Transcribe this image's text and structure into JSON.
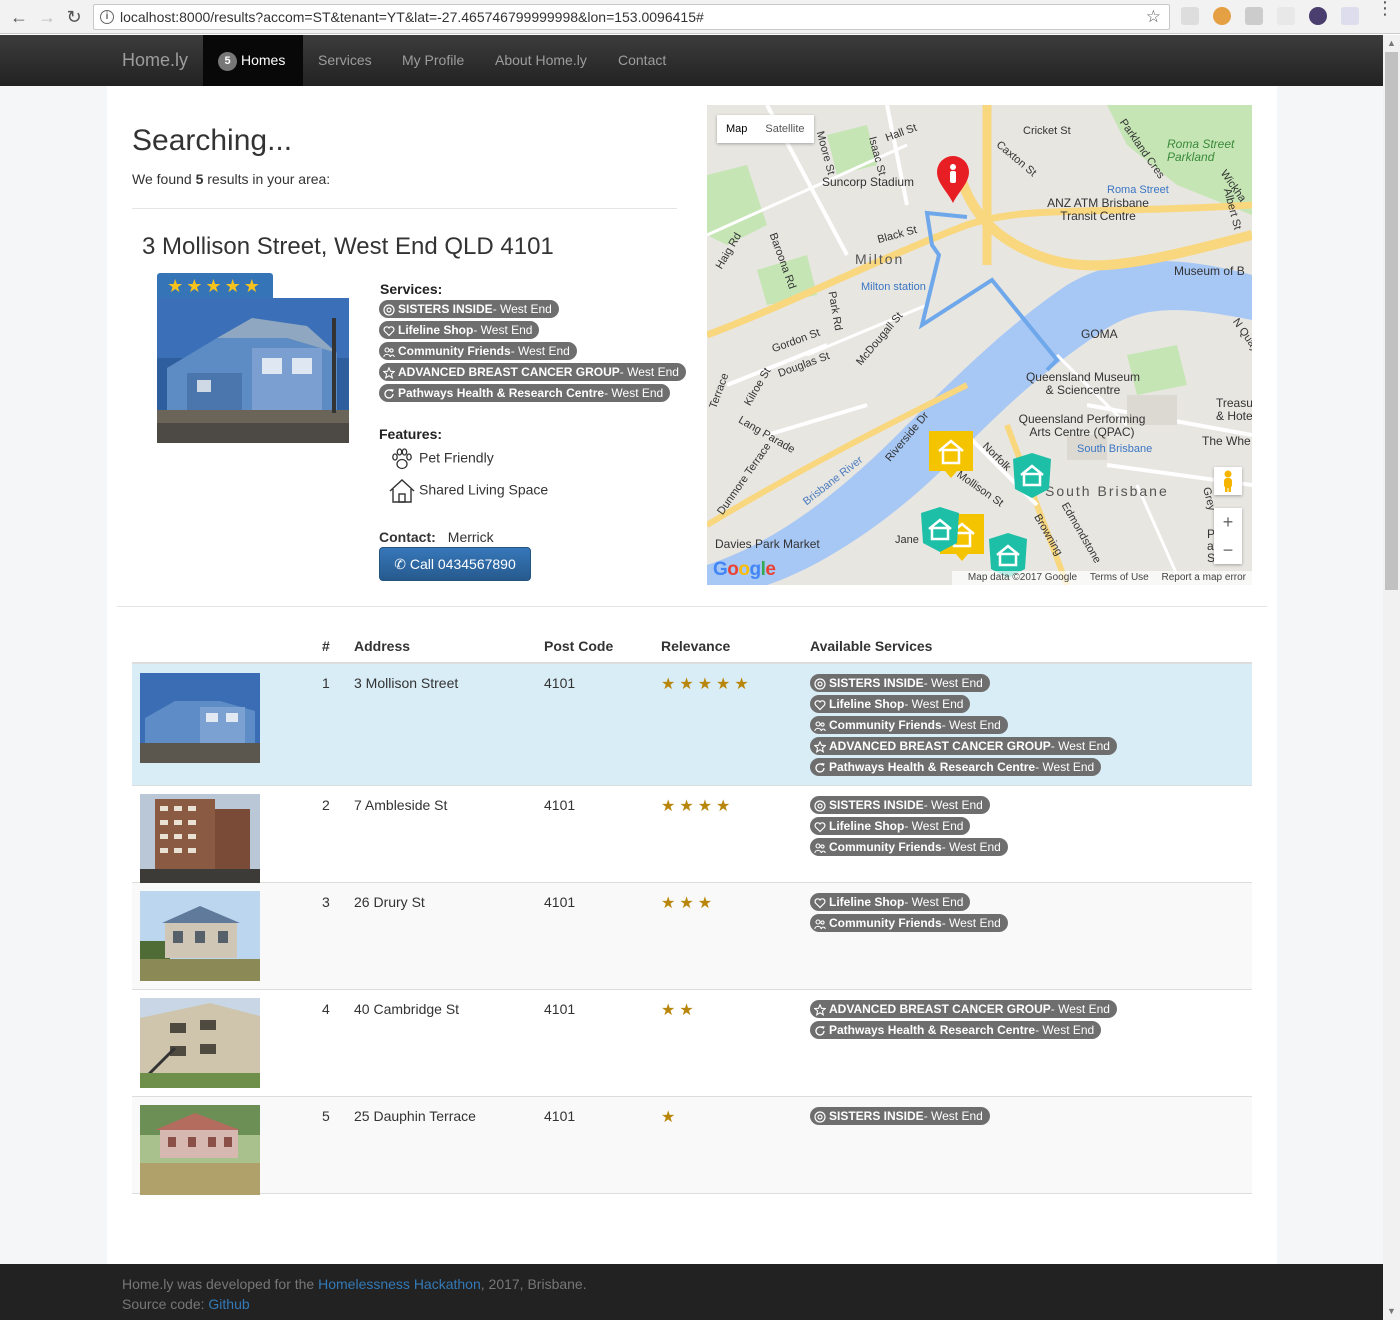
{
  "browser": {
    "url": "localhost:8000/results?accom=ST&tenant=YT&lat=-27.465746799999998&lon=153.0096415#"
  },
  "nav": {
    "brand": "Home.ly",
    "homes_count": "5",
    "items": [
      "Homes",
      "Services",
      "My Profile",
      "About Home.ly",
      "Contact"
    ]
  },
  "search": {
    "title": "Searching...",
    "found_prefix": "We found ",
    "found_count": "5",
    "found_suffix": " results in your area:"
  },
  "featured": {
    "address": "3 Mollison Street, West End QLD 4101",
    "rating": "★★★★★",
    "services_label": "Services:",
    "services": [
      {
        "icon": "support-icon",
        "name": "SISTERS INSIDE",
        "suffix": " - West End"
      },
      {
        "icon": "heart-icon",
        "name": "Lifeline Shop",
        "suffix": " - West End"
      },
      {
        "icon": "people-icon",
        "name": "Community Friends",
        "suffix": " - West End"
      },
      {
        "icon": "star-icon",
        "name": "ADVANCED BREAST CANCER GROUP",
        "suffix": " - West End"
      },
      {
        "icon": "refresh-icon",
        "name": "Pathways Health & Research Centre",
        "suffix": " - West End"
      }
    ],
    "features_label": "Features:",
    "features": [
      "Pet Friendly",
      "Shared Living Space"
    ],
    "contact_label": "Contact:",
    "contact_name": "Merrick",
    "call_label": "Call 0434567890"
  },
  "map": {
    "type_map": "Map",
    "type_satellite": "Satellite",
    "zoom_in": "+",
    "zoom_out": "−",
    "attribution": [
      "Map data ©2017 Google",
      "Terms of Use",
      "Report a map error"
    ],
    "labels": [
      "Suncorp Stadium",
      "Milton",
      "Milton station",
      "ANZ ATM Brisbane Transit Centre",
      "Roma Street Parkland",
      "Roma Street",
      "Museum of B",
      "GOMA",
      "Queensland Museum & Sciencentre",
      "Queensland Performing Arts Centre (QPAC)",
      "South Brisbane",
      "Brisbane River",
      "Davies Park Market",
      "Hall St",
      "Cricket St",
      "Caxton St",
      "Black St",
      "Park Rd",
      "Gordon St",
      "Douglas St",
      "McDougall St",
      "Lang Parade",
      "Dunmore Terrace",
      "Riverside Dr",
      "Mollison St",
      "Norfolk",
      "Jane",
      "Edmondstone",
      "Browning",
      "Baroona Rd",
      "Haig Rd",
      "Kilroe St",
      "Isaac St",
      "Moore St",
      "Parkland Cres",
      "Treasu & Hote",
      "The Whe",
      "Par at S",
      "Grey",
      "N Quay",
      "Wickha",
      "Albert St",
      "South Brisbane",
      "Terrace"
    ],
    "colors": {
      "water": "#a7c7f5",
      "road": "#f9d77f",
      "park": "#c5e5b5",
      "route": "#6fa8ea",
      "marker_home": "#f5c400",
      "marker_service": "#1dbfa7",
      "user_pin": "#e81e25"
    }
  },
  "table": {
    "headers": [
      "#",
      "Address",
      "Post Code",
      "Relevance",
      "Available Services"
    ],
    "rows": [
      {
        "num": "1",
        "address": "3 Mollison Street",
        "postcode": "4101",
        "stars": "★★★★★",
        "services": [
          {
            "icon": "support-icon",
            "name": "SISTERS INSIDE",
            "suffix": " - West End"
          },
          {
            "icon": "heart-icon",
            "name": "Lifeline Shop",
            "suffix": " - West End"
          },
          {
            "icon": "people-icon",
            "name": "Community Friends",
            "suffix": " - West End"
          },
          {
            "icon": "star-icon",
            "name": "ADVANCED BREAST CANCER GROUP",
            "suffix": " - West End"
          },
          {
            "icon": "refresh-icon",
            "name": "Pathways Health & Research Centre",
            "suffix": " - West End"
          }
        ]
      },
      {
        "num": "2",
        "address": "7 Ambleside St",
        "postcode": "4101",
        "stars": "★★★★",
        "services": [
          {
            "icon": "support-icon",
            "name": "SISTERS INSIDE",
            "suffix": " - West End"
          },
          {
            "icon": "heart-icon",
            "name": "Lifeline Shop",
            "suffix": " - West End"
          },
          {
            "icon": "people-icon",
            "name": "Community Friends",
            "suffix": " - West End"
          }
        ]
      },
      {
        "num": "3",
        "address": "26 Drury St",
        "postcode": "4101",
        "stars": "★★★",
        "services": [
          {
            "icon": "heart-icon",
            "name": "Lifeline Shop",
            "suffix": " - West End"
          },
          {
            "icon": "people-icon",
            "name": "Community Friends",
            "suffix": " - West End"
          }
        ]
      },
      {
        "num": "4",
        "address": "40 Cambridge St",
        "postcode": "4101",
        "stars": "★★",
        "services": [
          {
            "icon": "star-icon",
            "name": "ADVANCED BREAST CANCER GROUP",
            "suffix": " - West End"
          },
          {
            "icon": "refresh-icon",
            "name": "Pathways Health & Research Centre",
            "suffix": " - West End"
          }
        ]
      },
      {
        "num": "5",
        "address": "25 Dauphin Terrace",
        "postcode": "4101",
        "stars": "★",
        "services": [
          {
            "icon": "support-icon",
            "name": "SISTERS INSIDE",
            "suffix": " - West End"
          }
        ]
      }
    ]
  },
  "footer": {
    "line1_prefix": "Home.ly was developed for the ",
    "line1_link": "Homelessness Hackathon",
    "line1_suffix": ", 2017, Brisbane.",
    "line2_prefix": "Source code: ",
    "line2_link": "Github"
  }
}
